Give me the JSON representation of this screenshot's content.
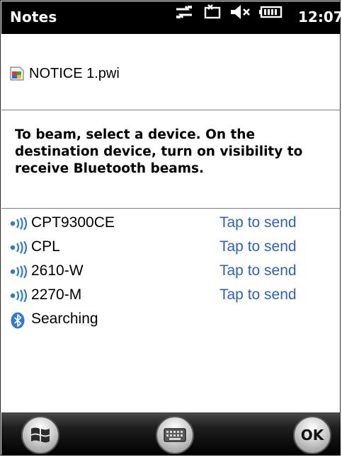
{
  "statusbar": {
    "title": "Notes",
    "time": "12:07",
    "icons": [
      "connectivity-icon",
      "message-icon",
      "speaker-muted-icon",
      "battery-icon"
    ]
  },
  "file": {
    "name": "NOTICE 1.pwi",
    "icon": "pwi-file-icon"
  },
  "instruction": "To beam, select a device. On the destination device, turn on visibility to receive Bluetooth beams.",
  "devices": [
    {
      "name": "CPT9300CE",
      "action": "Tap to send"
    },
    {
      "name": "CPL",
      "action": "Tap to send"
    },
    {
      "name": "2610-W",
      "action": "Tap to send"
    },
    {
      "name": "2270-M",
      "action": "Tap to send"
    }
  ],
  "bluetooth_status": {
    "label": "Searching",
    "icon": "bluetooth-icon"
  },
  "softkeys": {
    "start_icon": "windows-start-icon",
    "keyboard_icon": "keyboard-icon",
    "ok_label": "OK"
  },
  "colors": {
    "titlebar_bg": "#000000",
    "link": "#2e62b8",
    "divider": "#7d7b96",
    "signal": "#2e78d6"
  }
}
